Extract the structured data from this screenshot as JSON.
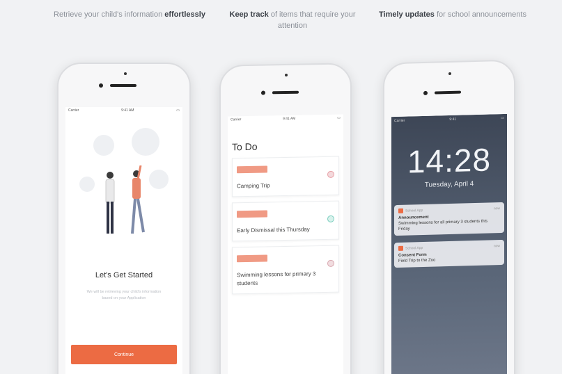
{
  "captions": [
    {
      "normal_before": "Retrieve your child's information ",
      "bold": "effortlessly",
      "normal_after": ""
    },
    {
      "normal_before": "",
      "bold": "Keep track",
      "normal_after": " of items that require your attention"
    },
    {
      "normal_before": "",
      "bold": "Timely updates",
      "normal_after": " for school announcements"
    }
  ],
  "onboarding": {
    "status_left": "Carrier",
    "status_time": "9:41 AM",
    "title": "Let's Get Started",
    "subtitle": "We will be retrieving your child's information based on your Application",
    "button_label": "Continue"
  },
  "todo": {
    "status_left": "Carrier",
    "status_time": "9:41 AM",
    "title": "To Do",
    "items": [
      {
        "text": "Camping Trip"
      },
      {
        "text": "Early Dismissal this Thursday"
      },
      {
        "text": "Swimming lessons for primary 3 students"
      }
    ]
  },
  "lockscreen": {
    "status_left": "Carrier",
    "status_time": "9:41",
    "time": "14:28",
    "date": "Tuesday, April 4",
    "notifications": [
      {
        "app": "School App",
        "when": "now",
        "title": "Announcement",
        "body": "Swimming lessons for all primary 3 students this Friday"
      },
      {
        "app": "School App",
        "when": "now",
        "title": "Consent Form",
        "body": "Field Trip to the Zoo"
      }
    ]
  },
  "colors": {
    "accent": "#ec6b43",
    "tag": "#f09a84",
    "background": "#f1f2f4"
  }
}
